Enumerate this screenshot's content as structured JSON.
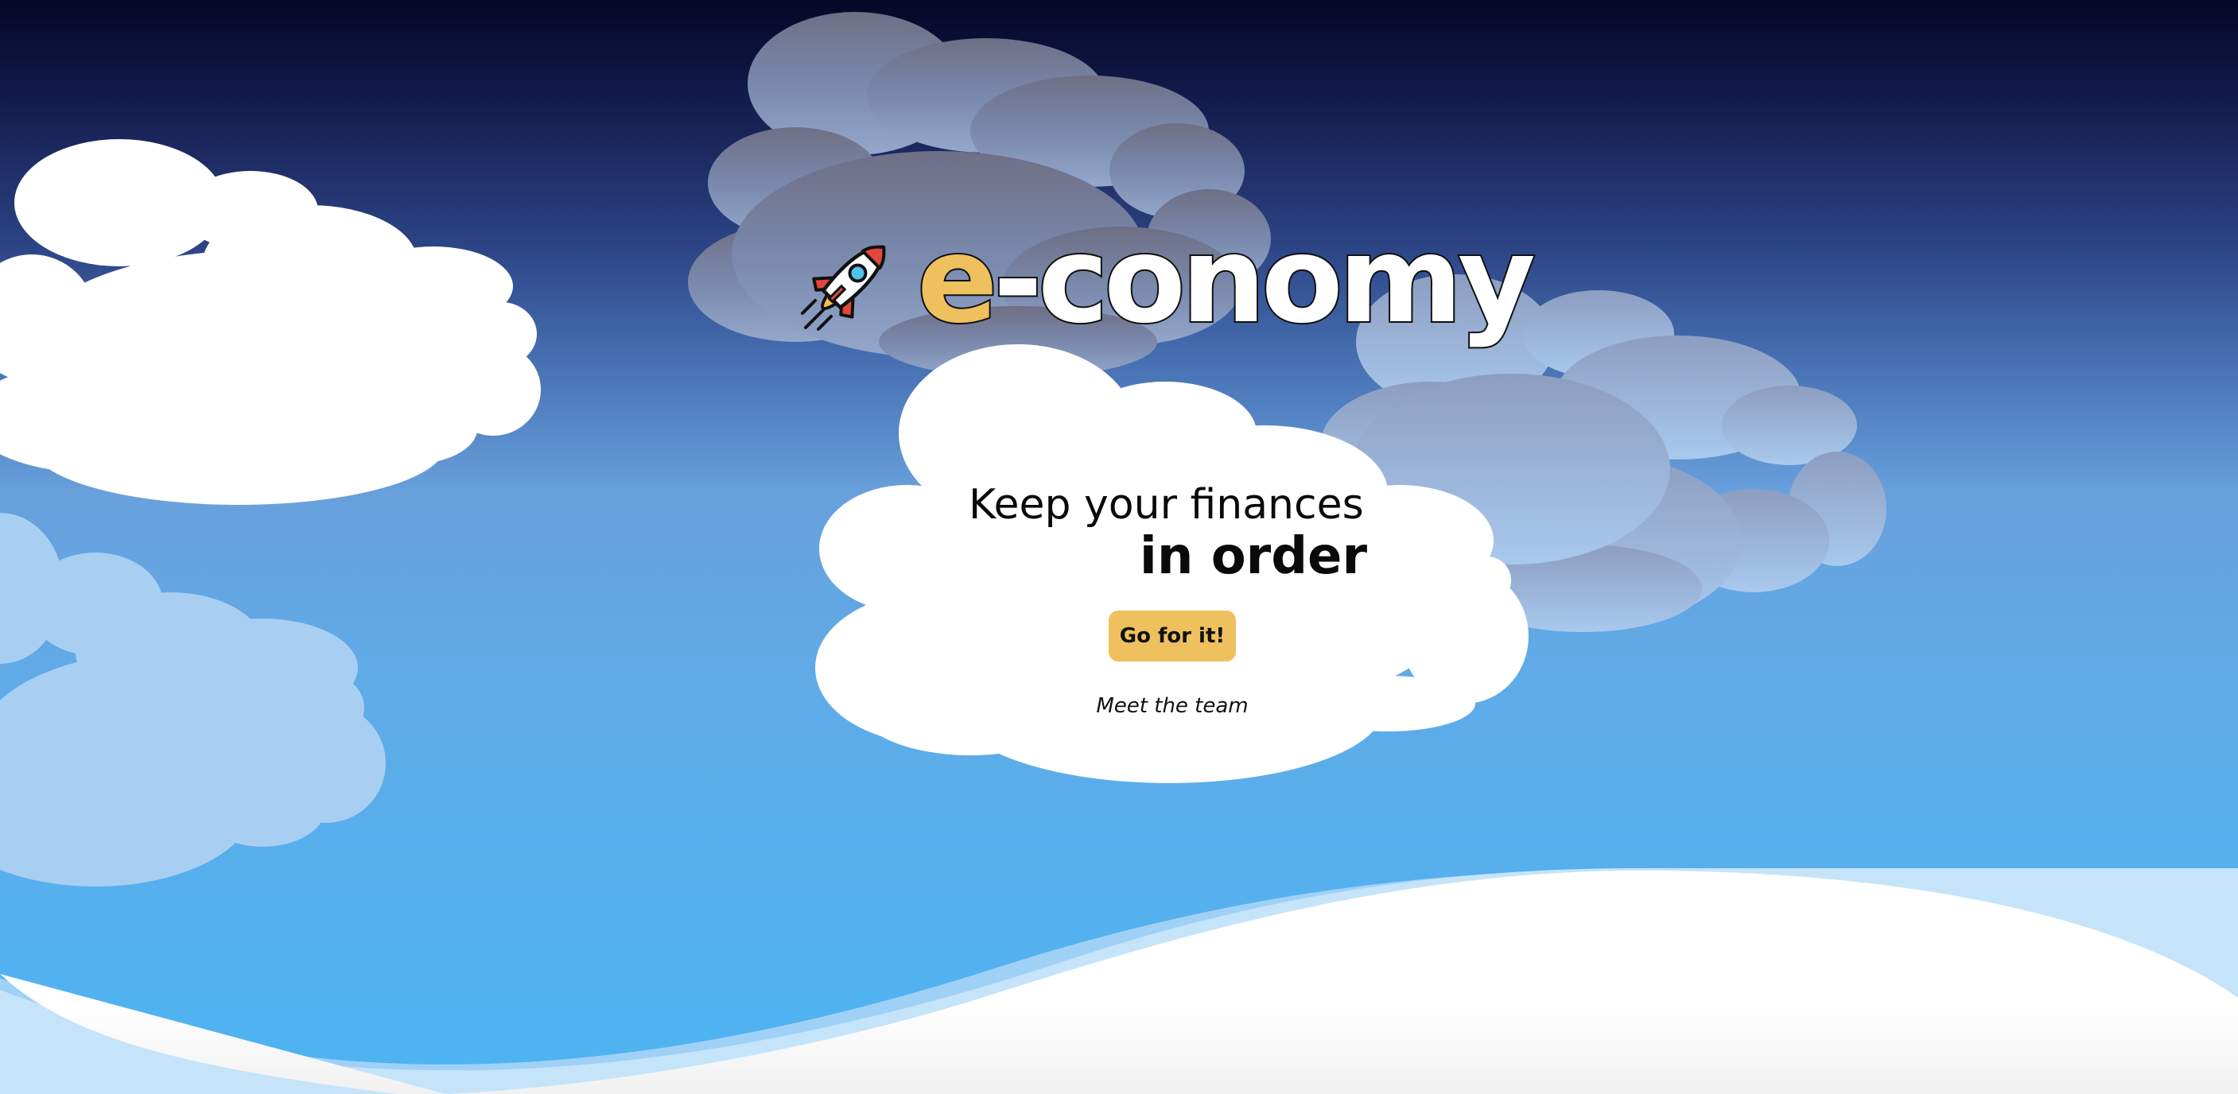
{
  "brand": {
    "name_prefix": "e",
    "name_rest": "-conomy",
    "accent_color": "#EEC05E",
    "logo_icon": "rocket-icon"
  },
  "hero": {
    "tagline_line1": "Keep your finances",
    "tagline_line2": "in order",
    "cta_label": "Go for it!",
    "team_link_label": "Meet the team"
  },
  "colors": {
    "sky_top": "#050726",
    "sky_mid": "#68A0DC",
    "sky_bottom": "#4DB4F2",
    "cloud": "#FFFFFF",
    "button": "#EEC05E"
  }
}
